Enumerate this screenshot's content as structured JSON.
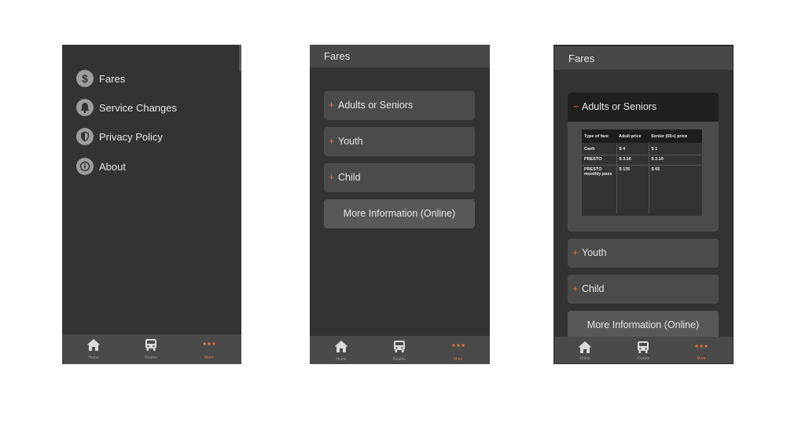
{
  "menu": {
    "items": [
      {
        "label": "Fares",
        "icon": "dollar-icon"
      },
      {
        "label": "Service Changes",
        "icon": "bell-icon"
      },
      {
        "label": "Privacy Policy",
        "icon": "shield-icon"
      },
      {
        "label": "About",
        "icon": "info-icon"
      }
    ]
  },
  "tabbar": {
    "home_label": "Home",
    "routes_label": "Routes",
    "more_label": "More",
    "active_color": "#e8703a"
  },
  "fares_screen": {
    "title": "Fares",
    "sections": [
      {
        "label": "Adults or Seniors",
        "expander": "+"
      },
      {
        "label": "Youth",
        "expander": "+"
      },
      {
        "label": "Child",
        "expander": "+"
      }
    ],
    "more_info_label": "More Information (Online)"
  },
  "fares_expanded": {
    "title": "Fares",
    "open_section": {
      "label": "Adults or Seniors",
      "expander": "−"
    },
    "table": {
      "headers": [
        "Type of fare",
        "Adult price",
        "Senior (65+) price"
      ],
      "rows": [
        [
          "Cash",
          "$ 4",
          "$ 1"
        ],
        [
          "PRESTO",
          "$ 3.16",
          "$ 2.10"
        ],
        [
          "PRESTO monthly pass",
          "$ 135",
          "$ 65"
        ]
      ]
    },
    "sections": [
      {
        "label": "Youth",
        "expander": "+"
      },
      {
        "label": "Child",
        "expander": "+"
      }
    ],
    "more_info_label": "More Information (Online)"
  }
}
